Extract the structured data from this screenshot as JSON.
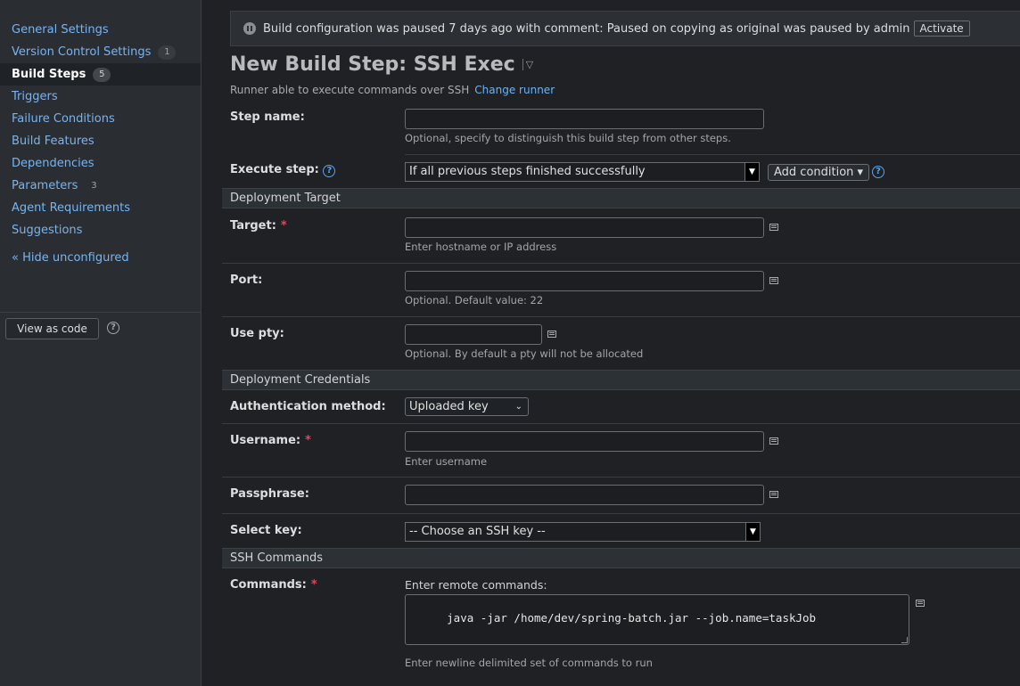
{
  "sidebar": {
    "items": [
      {
        "label": "General Settings",
        "badge": ""
      },
      {
        "label": "Version Control Settings",
        "badge": "1"
      },
      {
        "label": "Build Steps",
        "badge": "5"
      },
      {
        "label": "Triggers",
        "badge": ""
      },
      {
        "label": "Failure Conditions",
        "badge": ""
      },
      {
        "label": "Build Features",
        "badge": ""
      },
      {
        "label": "Dependencies",
        "badge": ""
      },
      {
        "label": "Parameters",
        "badge": "3"
      },
      {
        "label": "Agent Requirements",
        "badge": ""
      },
      {
        "label": "Suggestions",
        "badge": ""
      }
    ],
    "selected": "Build Steps",
    "hide_unconfigured": "« Hide unconfigured",
    "view_as_code": "View as code",
    "help_glyph": "?"
  },
  "banner": {
    "text": "Build configuration was paused 7 days ago with comment: Paused on copying as original was paused by admin",
    "activate": "Activate"
  },
  "header": {
    "title": "New Build Step: SSH Exec",
    "caret": "▽",
    "runner_desc": "Runner able to execute commands over SSH",
    "change_runner": "Change runner"
  },
  "form": {
    "step_name": {
      "label": "Step name:",
      "value": "",
      "hint": "Optional, specify to distinguish this build step from other steps."
    },
    "execute_step": {
      "label": "Execute step:",
      "value": "If all previous steps finished successfully",
      "add_condition": "Add condition ▾"
    },
    "sections": {
      "target": "Deployment Target",
      "credentials": "Deployment Credentials",
      "commands": "SSH Commands"
    },
    "target": {
      "label": "Target:",
      "value": "",
      "hint": "Enter hostname or IP address"
    },
    "port": {
      "label": "Port:",
      "value": "",
      "hint": "Optional. Default value: 22"
    },
    "use_pty": {
      "label": "Use pty:",
      "value": "",
      "hint": "Optional. By default a pty will not be allocated"
    },
    "auth_method": {
      "label": "Authentication method:",
      "value": "Uploaded key"
    },
    "username": {
      "label": "Username:",
      "value": "",
      "hint": "Enter username"
    },
    "passphrase": {
      "label": "Passphrase:",
      "value": ""
    },
    "select_key": {
      "label": "Select key:",
      "value": "-- Choose an SSH key --"
    },
    "commands": {
      "label": "Commands:",
      "caption": "Enter remote commands:",
      "value": "java -jar /home/dev/spring-batch.jar --job.name=taskJob",
      "hint": "Enter newline delimited set of commands to run"
    },
    "required_mark": "*"
  },
  "colors": {
    "link": "#79b4ef",
    "required": "#e0465d",
    "background": "#1f2124",
    "sidebar": "#2a2d31"
  }
}
